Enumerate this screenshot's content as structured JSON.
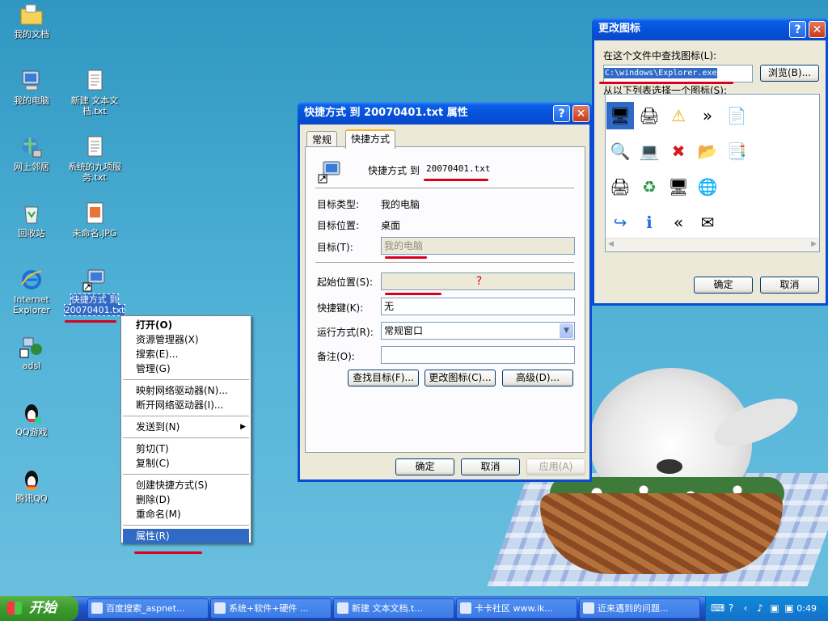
{
  "desktop": {
    "icons": [
      {
        "label": "我的文档"
      },
      {
        "label": "我的电脑"
      },
      {
        "label": "新建 文本文档.txt"
      },
      {
        "label": "网上邻居"
      },
      {
        "label": "系统的九项服务.txt"
      },
      {
        "label": "回收站"
      },
      {
        "label": "未命名.JPG"
      },
      {
        "label": "Internet Explorer"
      },
      {
        "label": "快捷方式 到 20070401.txt"
      },
      {
        "label": "adsl"
      },
      {
        "label": "QQ游戏"
      },
      {
        "label": "腾讯QQ"
      }
    ]
  },
  "context_menu": {
    "items": [
      {
        "label": "打开(O)"
      },
      {
        "label": "资源管理器(X)"
      },
      {
        "label": "搜索(E)..."
      },
      {
        "label": "管理(G)"
      },
      {
        "label": "映射网络驱动器(N)..."
      },
      {
        "label": "断开网络驱动器(I)..."
      },
      {
        "label": "发送到(N)"
      },
      {
        "label": "剪切(T)"
      },
      {
        "label": "复制(C)"
      },
      {
        "label": "创建快捷方式(S)"
      },
      {
        "label": "删除(D)"
      },
      {
        "label": "重命名(M)"
      },
      {
        "label": "属性(R)"
      }
    ]
  },
  "props_dialog": {
    "title": "快捷方式 到 20070401.txt 属性",
    "help": "?",
    "close": "✕",
    "tabs": [
      "常规",
      "快捷方式"
    ],
    "shortcut_name_prefix": "快捷方式 到",
    "shortcut_name_file": "20070401.txt",
    "target_type_label": "目标类型:",
    "target_type_value": "我的电脑",
    "target_location_label": "目标位置:",
    "target_location_value": "桌面",
    "target_label": "目标(T):",
    "target_value": "我的电脑",
    "start_in_label": "起始位置(S):",
    "start_in_value": "?",
    "hotkey_label": "快捷键(K):",
    "hotkey_value": "无",
    "run_label": "运行方式(R):",
    "run_value": "常规窗口",
    "comment_label": "备注(O):",
    "comment_value": "",
    "find_target_button": "查找目标(F)...",
    "change_icon_button": "更改图标(C)...",
    "advanced_button": "高级(D)...",
    "ok": "确定",
    "cancel": "取消",
    "apply": "应用(A)"
  },
  "change_icon_dialog": {
    "title": "更改图标",
    "help": "?",
    "close": "✕",
    "search_label": "在这个文件中查找图标(L):",
    "file_path": "C:\\windows\\Explorer.exe",
    "browse": "浏览(B)...",
    "select_label": "从以下列表选择一个图标(S):",
    "ok": "确定",
    "cancel": "取消",
    "icons": [
      "computer-icon",
      "printer-help-icon",
      "warning-icon",
      "chevrons-right-icon",
      "word-doc-icon",
      "search-folder-icon",
      "network-window-icon",
      "error-icon",
      "folder-icon",
      "server-doc-icon",
      "printer-icon",
      "recycle-icon",
      "monitor-icon",
      "globe-icon",
      "go-arrow-icon",
      "info-icon",
      "chevrons-left-icon",
      "envelope-icon"
    ],
    "glyphs": [
      "🖥",
      "🖨",
      "⚠",
      "»",
      "📄",
      "🔍",
      "💻",
      "✖",
      "📂",
      "📑",
      "🖨",
      "♻",
      "🖥",
      "🌐",
      "↪",
      "ℹ",
      "«",
      "✉"
    ]
  },
  "taskbar": {
    "start": "开始",
    "tasks": [
      {
        "label": "百度搜索_aspnet..."
      },
      {
        "label": "系统+软件+硬件 ..."
      },
      {
        "label": "新建 文本文档.t..."
      },
      {
        "label": "卡卡社区 www.ik..."
      },
      {
        "label": "近来遇到的问题..."
      }
    ],
    "clock": "0:49"
  }
}
